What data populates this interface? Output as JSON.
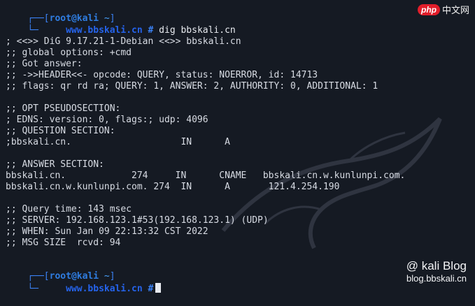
{
  "prompt": {
    "bracket_open": "┌──[",
    "user": "root",
    "at": "@",
    "host": "kali",
    "path": " ~",
    "bracket_close": "]",
    "corner": "└─",
    "url": "www.bbskali.cn",
    "hash": " #"
  },
  "command": " dig bbskali.cn",
  "output_lines": [
    "; <<>> DiG 9.17.21-1-Debian <<>> bbskali.cn",
    ";; global options: +cmd",
    ";; Got answer:",
    ";; ->>HEADER<<- opcode: QUERY, status: NOERROR, id: 14713",
    ";; flags: qr rd ra; QUERY: 1, ANSWER: 2, AUTHORITY: 0, ADDITIONAL: 1",
    "",
    ";; OPT PSEUDOSECTION:",
    "; EDNS: version: 0, flags:; udp: 4096",
    ";; QUESTION SECTION:",
    ";bbskali.cn.                    IN      A",
    "",
    ";; ANSWER SECTION:",
    "bbskali.cn.            274     IN      CNAME   bbskali.cn.w.kunlunpi.com.",
    "bbskali.cn.w.kunlunpi.com. 274  IN      A       121.4.254.190",
    "",
    ";; Query time: 143 msec",
    ";; SERVER: 192.168.123.1#53(192.168.123.1) (UDP)",
    ";; WHEN: Sun Jan 09 22:13:32 CST 2022",
    ";; MSG SIZE  rcvd: 94"
  ],
  "php_logo": {
    "badge": "php",
    "text": "中文网"
  },
  "watermark": {
    "line1": "@ kali Blog",
    "line2": "blog.bbskali.cn"
  }
}
